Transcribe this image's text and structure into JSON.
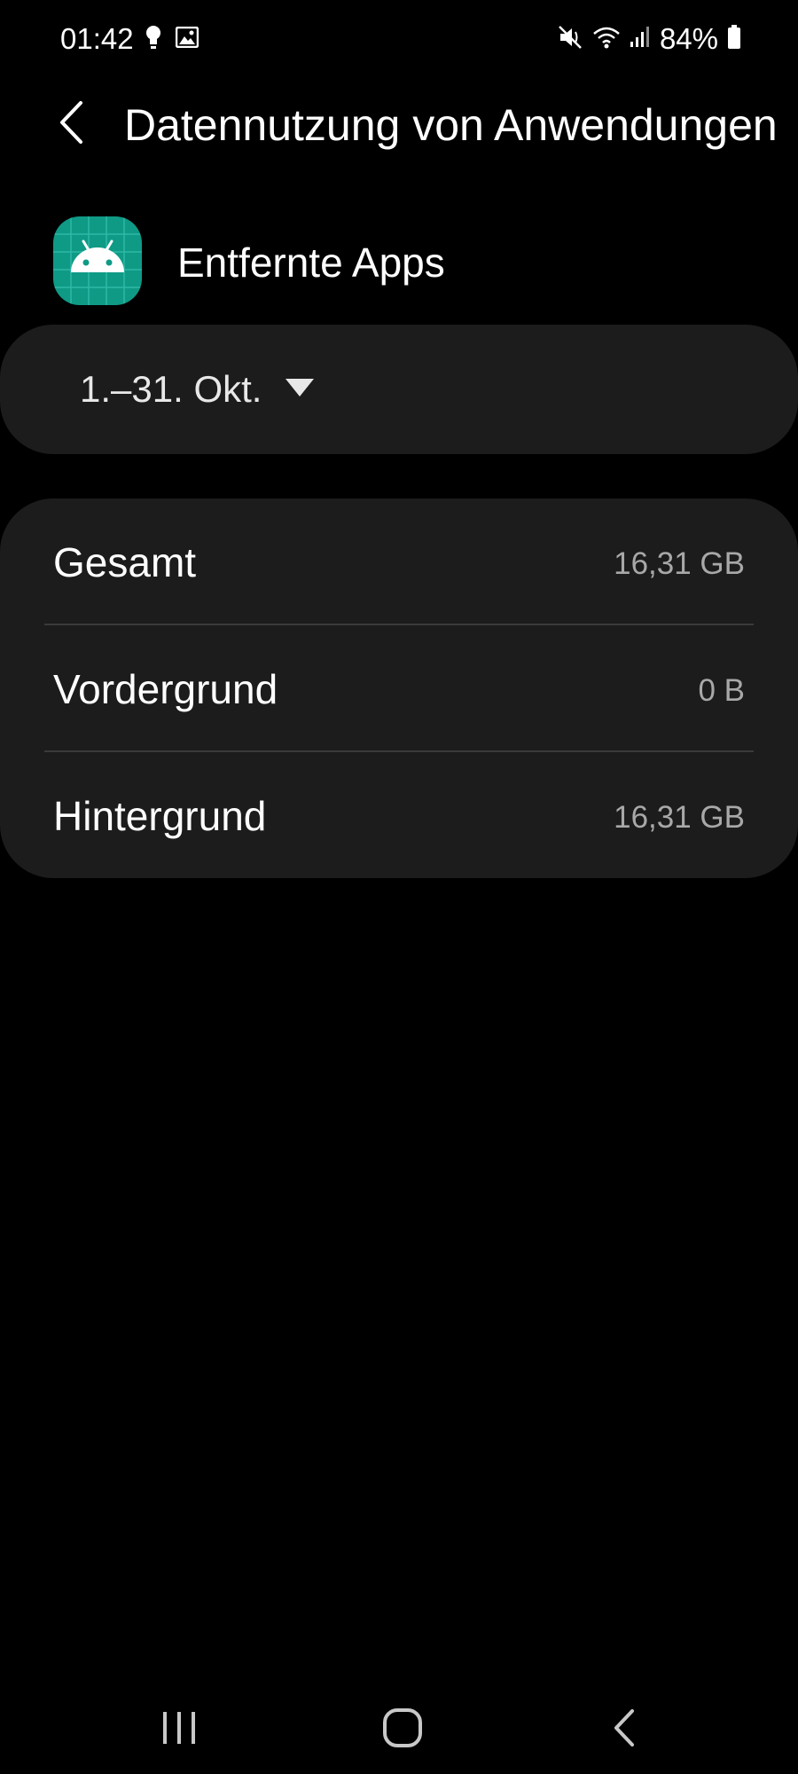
{
  "status_bar": {
    "time": "01:42",
    "left_icons": [
      "lightbulb-icon",
      "image-icon"
    ],
    "right_icons": [
      "mute-icon",
      "wifi-icon",
      "signal-icon",
      "battery-icon"
    ],
    "battery": "84%"
  },
  "header": {
    "back_icon": "chevron-left-icon",
    "title": "Datennutzung von Anwendungen"
  },
  "app": {
    "icon": "android-icon",
    "name": "Entfernte Apps",
    "icon_color": "#0f9a86"
  },
  "date_range": {
    "label": "1.–31. Okt.",
    "dropdown_icon": "dropdown-triangle-icon"
  },
  "usage": {
    "rows": [
      {
        "label": "Gesamt",
        "value": "16,31 GB"
      },
      {
        "label": "Vordergrund",
        "value": "0 B"
      },
      {
        "label": "Hintergrund",
        "value": "16,31 GB"
      }
    ]
  },
  "nav_bar": {
    "recents_icon": "recents-icon",
    "home_icon": "home-icon",
    "back_icon": "back-icon"
  },
  "colors": {
    "background": "#000000",
    "card": "#1c1c1c",
    "primary_text": "#ffffff",
    "secondary_text": "#a8a8a8"
  }
}
